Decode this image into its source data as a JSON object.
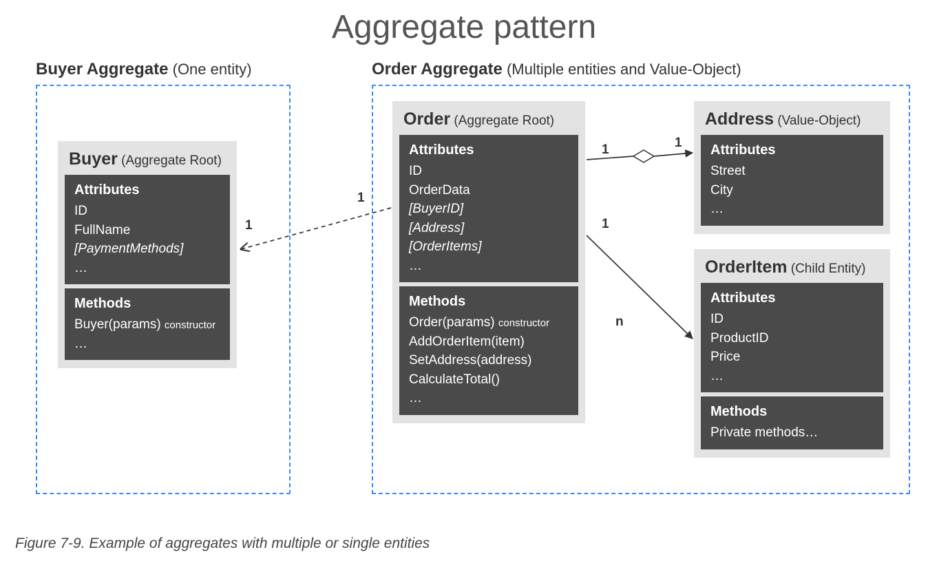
{
  "title": "Aggregate pattern",
  "caption": "Figure 7-9. Example of aggregates with multiple or single entities",
  "buyerAgg": {
    "headerBold": "Buyer Aggregate",
    "headerSub": " (One entity)"
  },
  "orderAgg": {
    "headerBold": "Order Aggregate",
    "headerSub": " (Multiple entities and Value-Object)"
  },
  "buyer": {
    "titleBold": "Buyer",
    "titleSub": " (Aggregate Root)",
    "attrHdr": "Attributes",
    "attr0": "ID",
    "attr1": "FullName",
    "attr2": "[PaymentMethods]",
    "attr3": "…",
    "methHdr": "Methods",
    "meth0_a": "Buyer(params) ",
    "meth0_b": "constructor",
    "meth1": "…"
  },
  "order": {
    "titleBold": "Order",
    "titleSub": " (Aggregate Root)",
    "attrHdr": "Attributes",
    "attr0": "ID",
    "attr1": "OrderData",
    "attr2": "[BuyerID]",
    "attr3": "[Address]",
    "attr4": "[OrderItems]",
    "attr5": "…",
    "methHdr": "Methods",
    "meth0_a": "Order(params) ",
    "meth0_b": "constructor",
    "meth1": "AddOrderItem(item)",
    "meth2": "SetAddress(address)",
    "meth3": "CalculateTotal()",
    "meth4": "…"
  },
  "address": {
    "titleBold": "Address",
    "titleSub": " (Value-Object)",
    "attrHdr": "Attributes",
    "attr0": "Street",
    "attr1": "City",
    "attr2": "…"
  },
  "orderItem": {
    "titleBold": "OrderItem",
    "titleSub": " (Child Entity)",
    "attrHdr": "Attributes",
    "attr0": "ID",
    "attr1": "ProductID",
    "attr2": "Price",
    "attr3": "…",
    "methHdr": "Methods",
    "meth0": "Private methods…"
  },
  "card": {
    "buyer_order_left": "1",
    "buyer_order_right": "1",
    "order_addr_left": "1",
    "order_addr_right": "1",
    "order_item_left": "1",
    "order_item_right": "n"
  }
}
